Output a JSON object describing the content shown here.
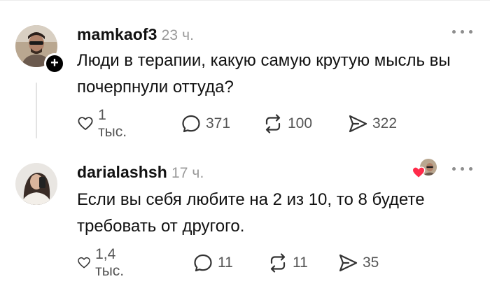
{
  "posts": [
    {
      "username": "mamkaof3",
      "time": "23 ч.",
      "text": "Люди в терапии, какую самую крутую мысль вы почерпнули оттуда?",
      "likes": "1 тыс.",
      "comments": "371",
      "reposts": "100",
      "shares": "322"
    },
    {
      "username": "darialashsh",
      "time": "17 ч.",
      "text": "Если вы себя любите на 2 из 10, то 8 будете требовать от другого.",
      "likes": "1,4 тыс.",
      "comments": "11",
      "reposts": "11",
      "shares": "35"
    }
  ],
  "icons": {
    "like": "heart-outline-icon",
    "comment": "speech-bubble-icon",
    "repost": "repost-arrows-icon",
    "share": "paper-plane-icon",
    "follow": "plus-icon",
    "more": "ellipsis-icon",
    "liked_by_author": "red-heart-icon"
  },
  "colors": {
    "text": "#111111",
    "secondary": "#9a9a9a",
    "heart_red": "#ff2b4a"
  },
  "follow_badge": "+"
}
